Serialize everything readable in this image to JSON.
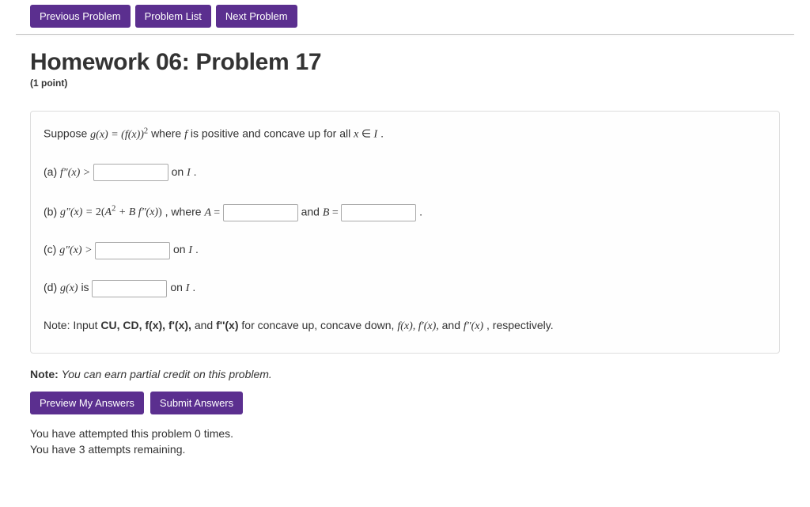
{
  "nav": {
    "previous": "Previous Problem",
    "list": "Problem List",
    "next": "Next Problem"
  },
  "header": {
    "title": "Homework 06: Problem 17",
    "points": "(1 point)"
  },
  "problem": {
    "intro_prefix": "Suppose ",
    "intro_expr": "g(x) = (f(x))²",
    "intro_mid": " where ",
    "intro_f": "f",
    "intro_after": " is positive and concave up for all ",
    "intro_domain": "x ∈ I",
    "intro_end": ".",
    "a": {
      "label": "(a) ",
      "expr": "f″(x) > ",
      "after": " on ",
      "set": "I",
      "end": "."
    },
    "b": {
      "label": "(b) ",
      "expr": "g″(x) = 2(A² + B f″(x))",
      "mid1": ", where ",
      "Aeq": "A = ",
      "mid2": " and ",
      "Beq": "B = ",
      "end": " ."
    },
    "c": {
      "label": "(c) ",
      "expr": "g″(x) > ",
      "after": " on ",
      "set": "I",
      "end": "."
    },
    "d": {
      "label": "(d) ",
      "expr": "g(x)",
      "is": " is ",
      "after": " on ",
      "set": "I",
      "end": "."
    },
    "note_prefix": "Note: Input ",
    "note_bold": "CU, CD, f(x), f'(x),",
    "note_mid1": " and ",
    "note_bold2": "f''(x)",
    "note_mid2": " for concave up, concave down, ",
    "note_math": "f(x), f′(x),",
    "note_mid3": " and ",
    "note_math2": "f″(x)",
    "note_end": ", respectively."
  },
  "footer": {
    "partial_bold": "Note:",
    "partial_text": " You can earn partial credit on this problem.",
    "preview": "Preview My Answers",
    "submit": "Submit Answers",
    "attempts1": "You have attempted this problem 0 times.",
    "attempts2": "You have 3 attempts remaining."
  }
}
